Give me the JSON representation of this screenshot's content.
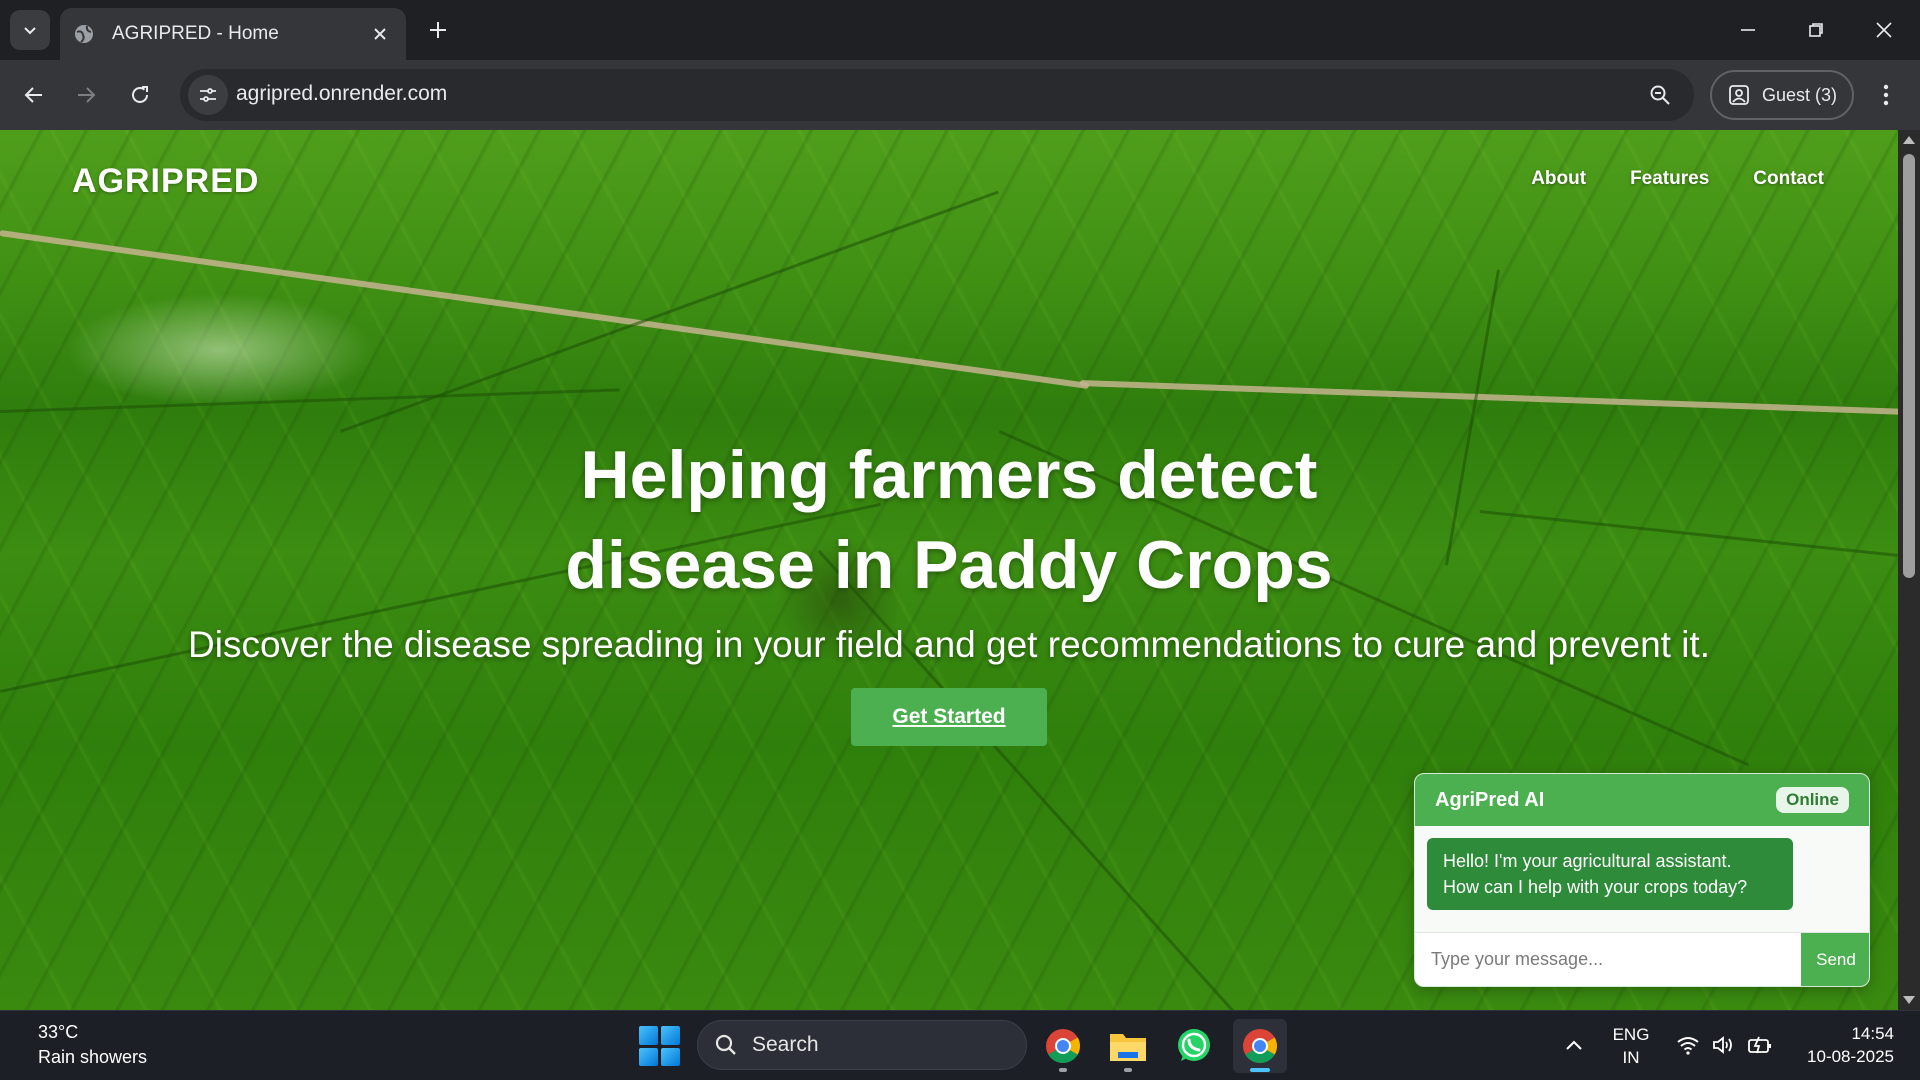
{
  "browser": {
    "tab_title": "AGRIPRED - Home",
    "url": "agripred.onrender.com",
    "profile_label": "Guest (3)"
  },
  "site": {
    "logo": "AGRIPRED",
    "nav": [
      "About",
      "Features",
      "Contact"
    ],
    "hero_title_line1": "Helping farmers detect",
    "hero_title_line2": "disease in Paddy Crops",
    "hero_subtitle": "Discover the disease spreading in your field and get recommendations to cure and prevent it.",
    "cta_label": "Get Started"
  },
  "chat": {
    "title": "AgriPred AI",
    "status": "Online",
    "message_line1": "Hello! I'm your agricultural assistant.",
    "message_line2": "How can I help with your crops today?",
    "input_placeholder": "Type your message...",
    "send_label": "Send"
  },
  "taskbar": {
    "weather_temp": "33°C",
    "weather_desc": "Rain showers",
    "search_label": "Search",
    "lang_line1": "ENG",
    "lang_line2": "IN",
    "time": "14:54",
    "date": "10-08-2025"
  },
  "colors": {
    "accent_green": "#4caf50",
    "bubble_green": "#2e8b3a",
    "chrome_dark": "#35363a"
  }
}
